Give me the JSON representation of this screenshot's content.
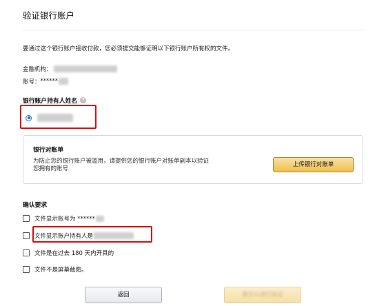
{
  "page": {
    "title": "验证银行账户",
    "intro": "要通过这个银行账户接收付款，您必须提交能够证明以下银行账户所有权的文件。",
    "bank_label": "金融机构：",
    "account_label": "账号：",
    "account_masked": "******"
  },
  "holder": {
    "heading": "银行账户持有人姓名",
    "help_icon": "?"
  },
  "statement": {
    "heading": "银行对账单",
    "description_line1": "为防止您的银行账户被滥用，请提供您的银行账户对账单副本以验证",
    "description_line2": "您拥有的账号",
    "upload_label": "上传银行对账单"
  },
  "requirements": {
    "heading": "确认要求",
    "items": [
      {
        "label": "文件显示账号为 ******"
      },
      {
        "label": "文件显示账户持有人是"
      },
      {
        "label": "文件是在过去 180 天内开具的"
      },
      {
        "label": "文件不是屏幕截图。"
      }
    ]
  },
  "actions": {
    "back_label": "返回",
    "submit_label": "提交以进行验证"
  },
  "colors": {
    "highlight_border": "#d70e0e",
    "radio_selected": "#1a66cc",
    "upload_button": "#f0c14b"
  }
}
